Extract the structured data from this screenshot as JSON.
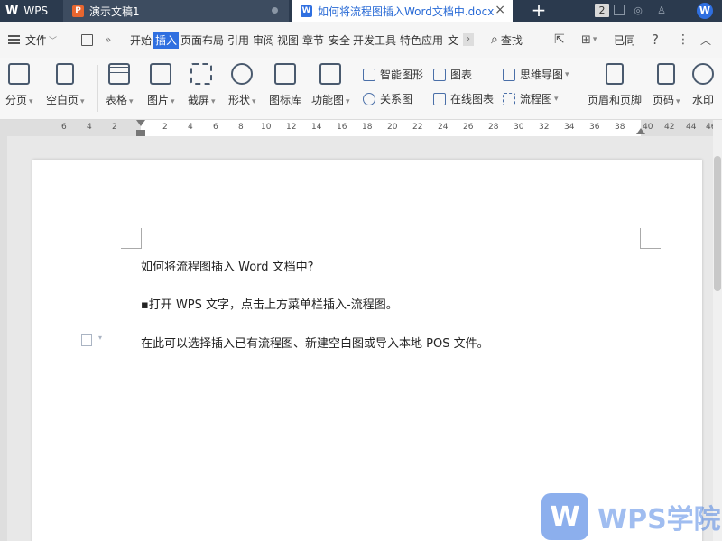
{
  "titlebar": {
    "wps_label": "WPS",
    "tabs": [
      {
        "label": "演示文稿1",
        "type_letter": "P"
      },
      {
        "label": "如何将流程图插入Word文档中.docx",
        "type_letter": "W"
      }
    ],
    "plus": "+",
    "window_count": "2",
    "close": "×"
  },
  "menubar": {
    "file": "文件",
    "items": [
      "开始",
      "插入",
      "页面布局",
      "引用",
      "审阅",
      "视图",
      "章节",
      "安全",
      "开发工具",
      "特色应用",
      "文"
    ],
    "active": "插入",
    "search": "查找",
    "sync": "已同",
    "help": "?",
    "more": "⋮"
  },
  "ribbon": {
    "big": [
      "分页",
      "空白页",
      "表格",
      "图片",
      "截屏",
      "形状",
      "图标库",
      "功能图"
    ],
    "small_col1": [
      "智能图形",
      "关系图"
    ],
    "small_col2": [
      "图表",
      "在线图表"
    ],
    "small_col3": [
      "思维导图",
      "流程图"
    ],
    "right": [
      "页眉和页脚",
      "页码",
      "水印"
    ]
  },
  "ruler": {
    "left_ticks": [
      "6",
      "4",
      "2"
    ],
    "ticks": [
      "2",
      "4",
      "6",
      "8",
      "10",
      "12",
      "14",
      "16",
      "18",
      "20",
      "22",
      "24",
      "26",
      "28",
      "30",
      "32",
      "34",
      "36",
      "38"
    ],
    "right_ticks": [
      "40",
      "42",
      "44",
      "46"
    ]
  },
  "document": {
    "line1": "如何将流程图插入 Word 文档中?",
    "line2": "▪打开 WPS 文字，点击上方菜单栏插入-流程图。",
    "line3": "在此可以选择插入已有流程图、新建空白图或导入本地 POS 文件。"
  },
  "watermark": {
    "logo_letter": "W",
    "text": "WPS学院"
  }
}
